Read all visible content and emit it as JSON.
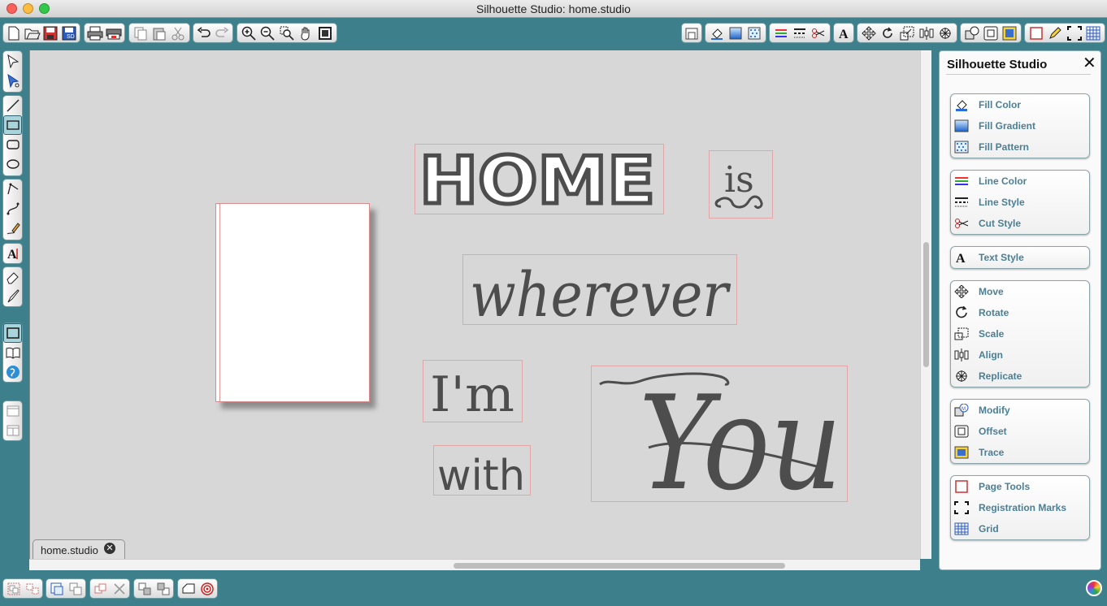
{
  "window": {
    "title": "Silhouette Studio: home.studio"
  },
  "document_tab": {
    "label": "home.studio"
  },
  "panel": {
    "title": "Silhouette Studio",
    "groups": [
      {
        "items": [
          {
            "label": "Fill Color",
            "icon": "fill-color-icon"
          },
          {
            "label": "Fill Gradient",
            "icon": "fill-gradient-icon"
          },
          {
            "label": "Fill Pattern",
            "icon": "fill-pattern-icon"
          }
        ]
      },
      {
        "items": [
          {
            "label": "Line Color",
            "icon": "line-color-icon"
          },
          {
            "label": "Line Style",
            "icon": "line-style-icon"
          },
          {
            "label": "Cut Style",
            "icon": "cut-style-icon"
          }
        ]
      },
      {
        "items": [
          {
            "label": "Text Style",
            "icon": "text-style-icon"
          }
        ]
      },
      {
        "items": [
          {
            "label": "Move",
            "icon": "move-icon"
          },
          {
            "label": "Rotate",
            "icon": "rotate-icon"
          },
          {
            "label": "Scale",
            "icon": "scale-icon"
          },
          {
            "label": "Align",
            "icon": "align-icon"
          },
          {
            "label": "Replicate",
            "icon": "replicate-icon"
          }
        ]
      },
      {
        "items": [
          {
            "label": "Modify",
            "icon": "modify-icon"
          },
          {
            "label": "Offset",
            "icon": "offset-icon"
          },
          {
            "label": "Trace",
            "icon": "trace-icon"
          }
        ]
      },
      {
        "items": [
          {
            "label": "Page Tools",
            "icon": "page-tools-icon"
          },
          {
            "label": "Registration Marks",
            "icon": "registration-marks-icon"
          },
          {
            "label": "Grid",
            "icon": "grid-icon"
          }
        ]
      }
    ]
  },
  "canvas": {
    "words": [
      "HOME",
      "is",
      "wherever",
      "I'm",
      "with",
      "You"
    ]
  },
  "colors": {
    "accent": "#3d7f8a",
    "panel_text": "#4a7f96",
    "word_fill": "#4d4d4d",
    "selection_box": "#e3a6a6"
  }
}
